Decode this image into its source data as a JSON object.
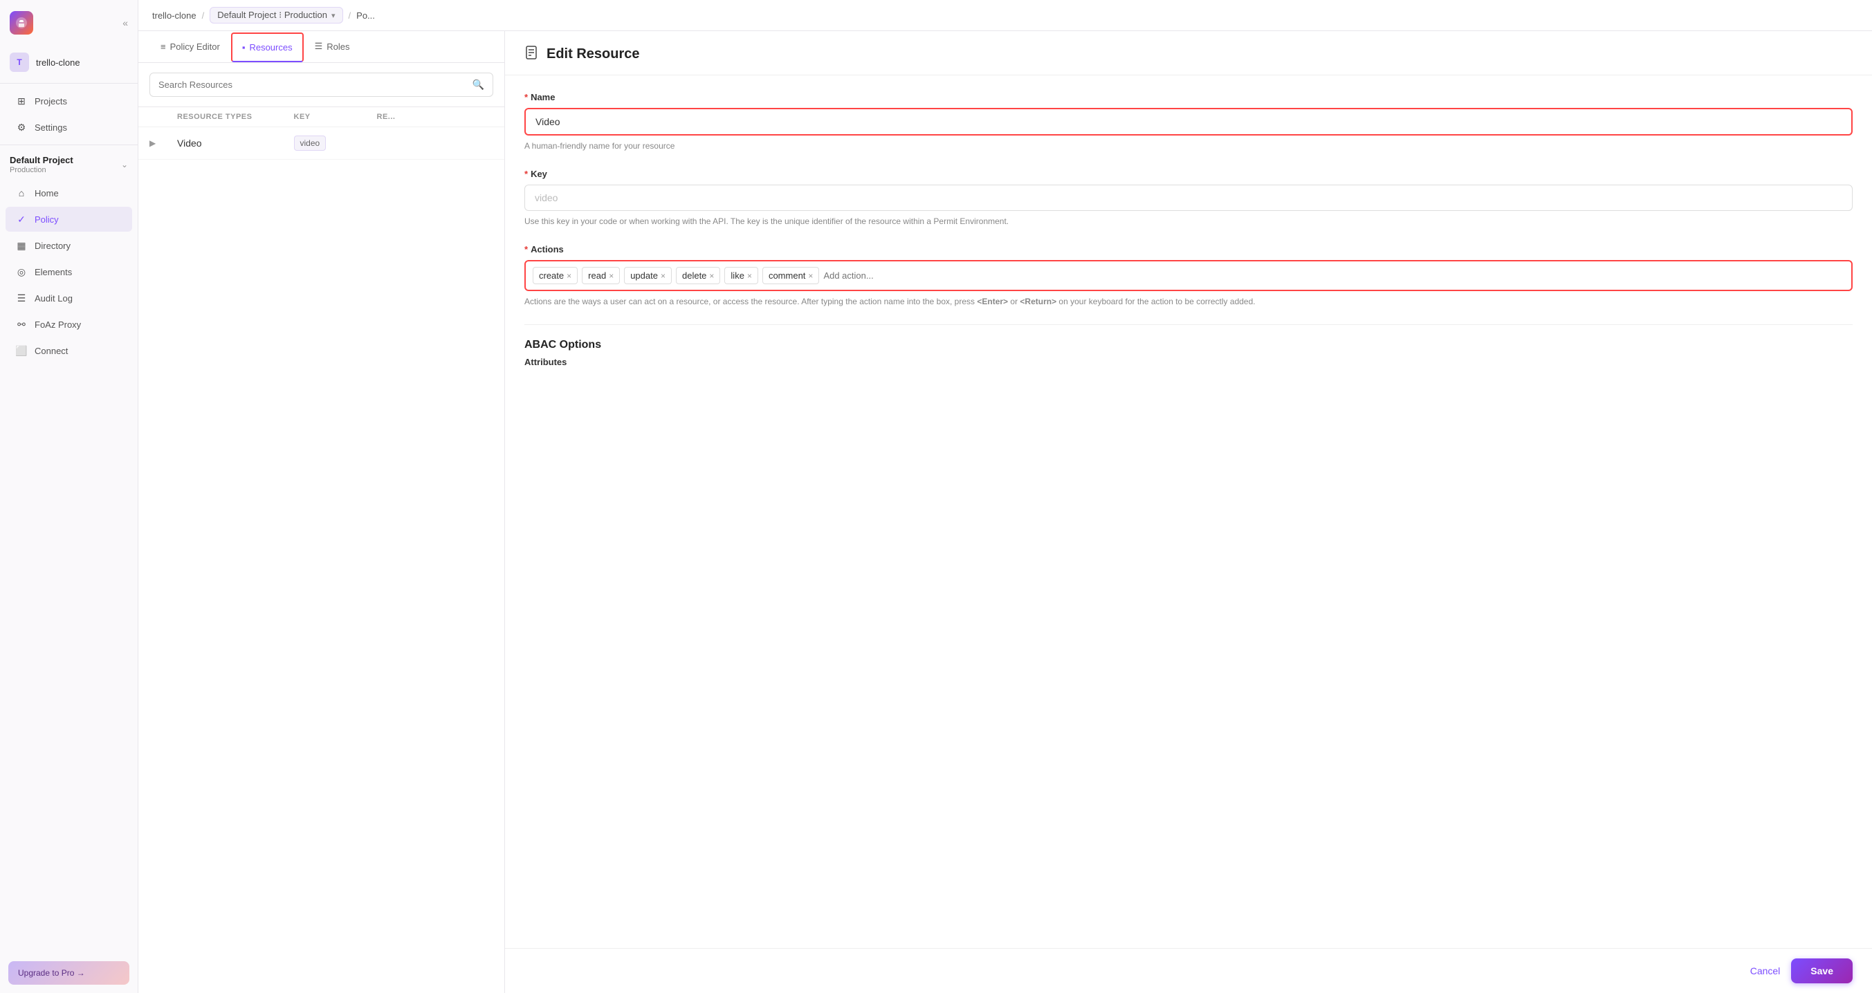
{
  "sidebar": {
    "logo_icon": "🦊",
    "collapse_label": "«",
    "workspace": {
      "avatar": "T",
      "name": "trello-clone"
    },
    "nav_items": [
      {
        "id": "projects",
        "label": "Projects",
        "icon": "⊞"
      },
      {
        "id": "settings",
        "label": "Settings",
        "icon": "⚙"
      }
    ],
    "project": {
      "name": "Default Project",
      "env": "Production",
      "toggle_icon": "⌄"
    },
    "project_nav": [
      {
        "id": "home",
        "label": "Home",
        "icon": "⌂"
      },
      {
        "id": "policy",
        "label": "Policy",
        "icon": "✓",
        "active": true
      },
      {
        "id": "directory",
        "label": "Directory",
        "icon": "▦"
      },
      {
        "id": "elements",
        "label": "Elements",
        "icon": "◎"
      },
      {
        "id": "audit-log",
        "label": "Audit Log",
        "icon": "☰"
      },
      {
        "id": "foaz-proxy",
        "label": "FoAz Proxy",
        "icon": "⚯"
      },
      {
        "id": "connect",
        "label": "Connect",
        "icon": "⬜"
      }
    ],
    "upgrade_label": "Upgrade to Pro →"
  },
  "breadcrumb": {
    "workspace": "trello-clone",
    "separator1": "/",
    "env_label": "Default Project ⁝ Production",
    "separator2": "/",
    "current": "Po...",
    "expand": "»"
  },
  "tabs": [
    {
      "id": "policy-editor",
      "label": "Policy Editor",
      "icon": "≡",
      "active": false
    },
    {
      "id": "resources",
      "label": "Resources",
      "icon": "▪",
      "active": true
    },
    {
      "id": "roles",
      "label": "Roles",
      "icon": "☰",
      "active": false
    }
  ],
  "search": {
    "placeholder": "Search Resources",
    "icon": "🔍"
  },
  "table": {
    "headers": [
      "",
      "RESOURCE TYPES",
      "KEY",
      "RE..."
    ],
    "rows": [
      {
        "name": "Video",
        "key": "video"
      }
    ]
  },
  "edit_resource": {
    "title": "Edit Resource",
    "icon": "📄",
    "fields": {
      "name": {
        "label": "Name",
        "required": true,
        "value": "Video",
        "hint": "A human-friendly name for your resource"
      },
      "key": {
        "label": "Key",
        "required": true,
        "value": "",
        "placeholder": "video",
        "hint": "Use this key in your code or when working with the API. The key is the unique identifier of the resource within a Permit Environment."
      },
      "actions": {
        "label": "Actions",
        "required": true,
        "tags": [
          "create",
          "read",
          "update",
          "delete",
          "like",
          "comment"
        ],
        "add_placeholder": "Add action...",
        "hint": "Actions are the ways a user can act on a resource, or access the resource. After typing the action name into the box, press <Enter> or <Return> on your keyboard for the action to be correctly added."
      }
    },
    "abac": {
      "section_title": "ABAC Options",
      "attributes_label": "Attributes"
    },
    "footer": {
      "cancel_label": "Cancel",
      "save_label": "Save"
    }
  }
}
